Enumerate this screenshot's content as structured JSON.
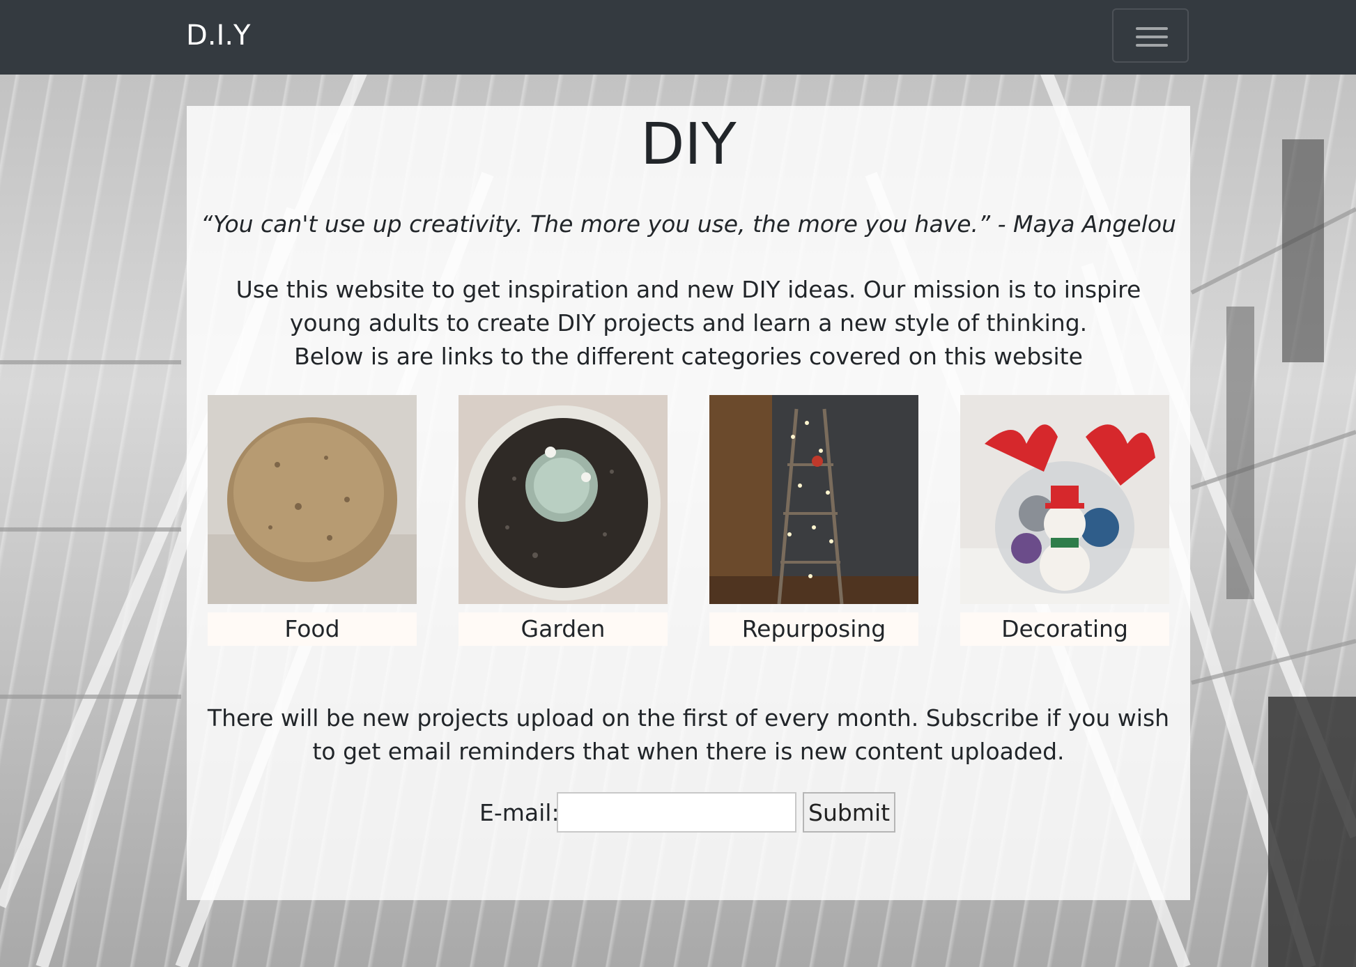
{
  "navbar": {
    "brand": "D.I.Y",
    "toggler_icon": "hamburger-menu-icon"
  },
  "main": {
    "title": "DIY",
    "quote": "“You can't use up creativity. The more you use, the more you have.” - Maya Angelou",
    "intro_line1": "Use this website to get inspiration and new DIY ideas. Our mission is to inspire young adults to create DIY projects and learn a new style of thinking.",
    "intro_line2": "Below is are links to the different categories covered on this website",
    "categories": [
      {
        "label": "Food"
      },
      {
        "label": "Garden"
      },
      {
        "label": "Repurposing"
      },
      {
        "label": "Decorating"
      }
    ],
    "subscribe_text": "There will be new projects upload on the first of every month. Subscribe if you wish to get email reminders that when there is new content uploaded.",
    "email_label": "E-mail:",
    "email_value": "",
    "submit_label": "Submit"
  },
  "colors": {
    "navbar": "#343a40",
    "text": "#212529"
  }
}
